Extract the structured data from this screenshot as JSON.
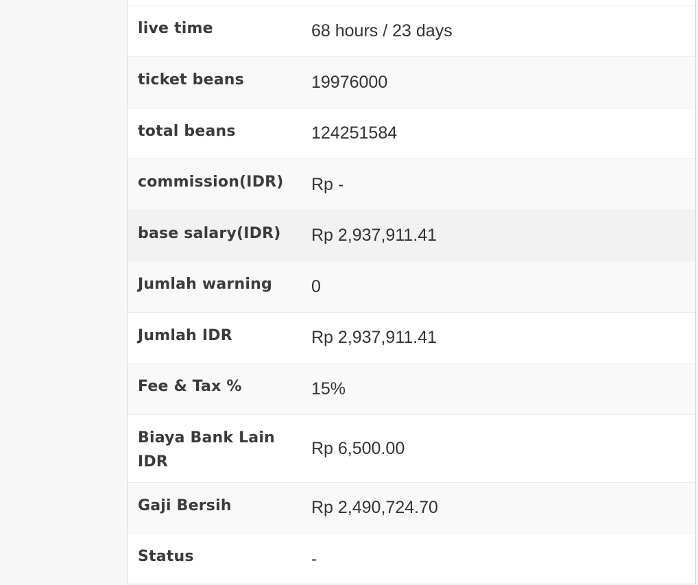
{
  "table": {
    "rows": [
      {
        "label": "live time",
        "value": "68 hours / 23 days"
      },
      {
        "label": "ticket beans",
        "value": "19976000"
      },
      {
        "label": "total beans",
        "value": "124251584"
      },
      {
        "label": "commission(IDR)",
        "value": "Rp -"
      },
      {
        "label": "base salary(IDR)",
        "value": "Rp 2,937,911.41"
      },
      {
        "label": "Jumlah warning",
        "value": "0"
      },
      {
        "label": "Jumlah IDR",
        "value": "Rp 2,937,911.41"
      },
      {
        "label": "Fee & Tax %",
        "value": "15%"
      },
      {
        "label": "Biaya Bank Lain IDR",
        "value": "Rp 6,500.00"
      },
      {
        "label": "Gaji Bersih",
        "value": "Rp 2,490,724.70"
      },
      {
        "label": "Status",
        "value": "-"
      }
    ]
  }
}
